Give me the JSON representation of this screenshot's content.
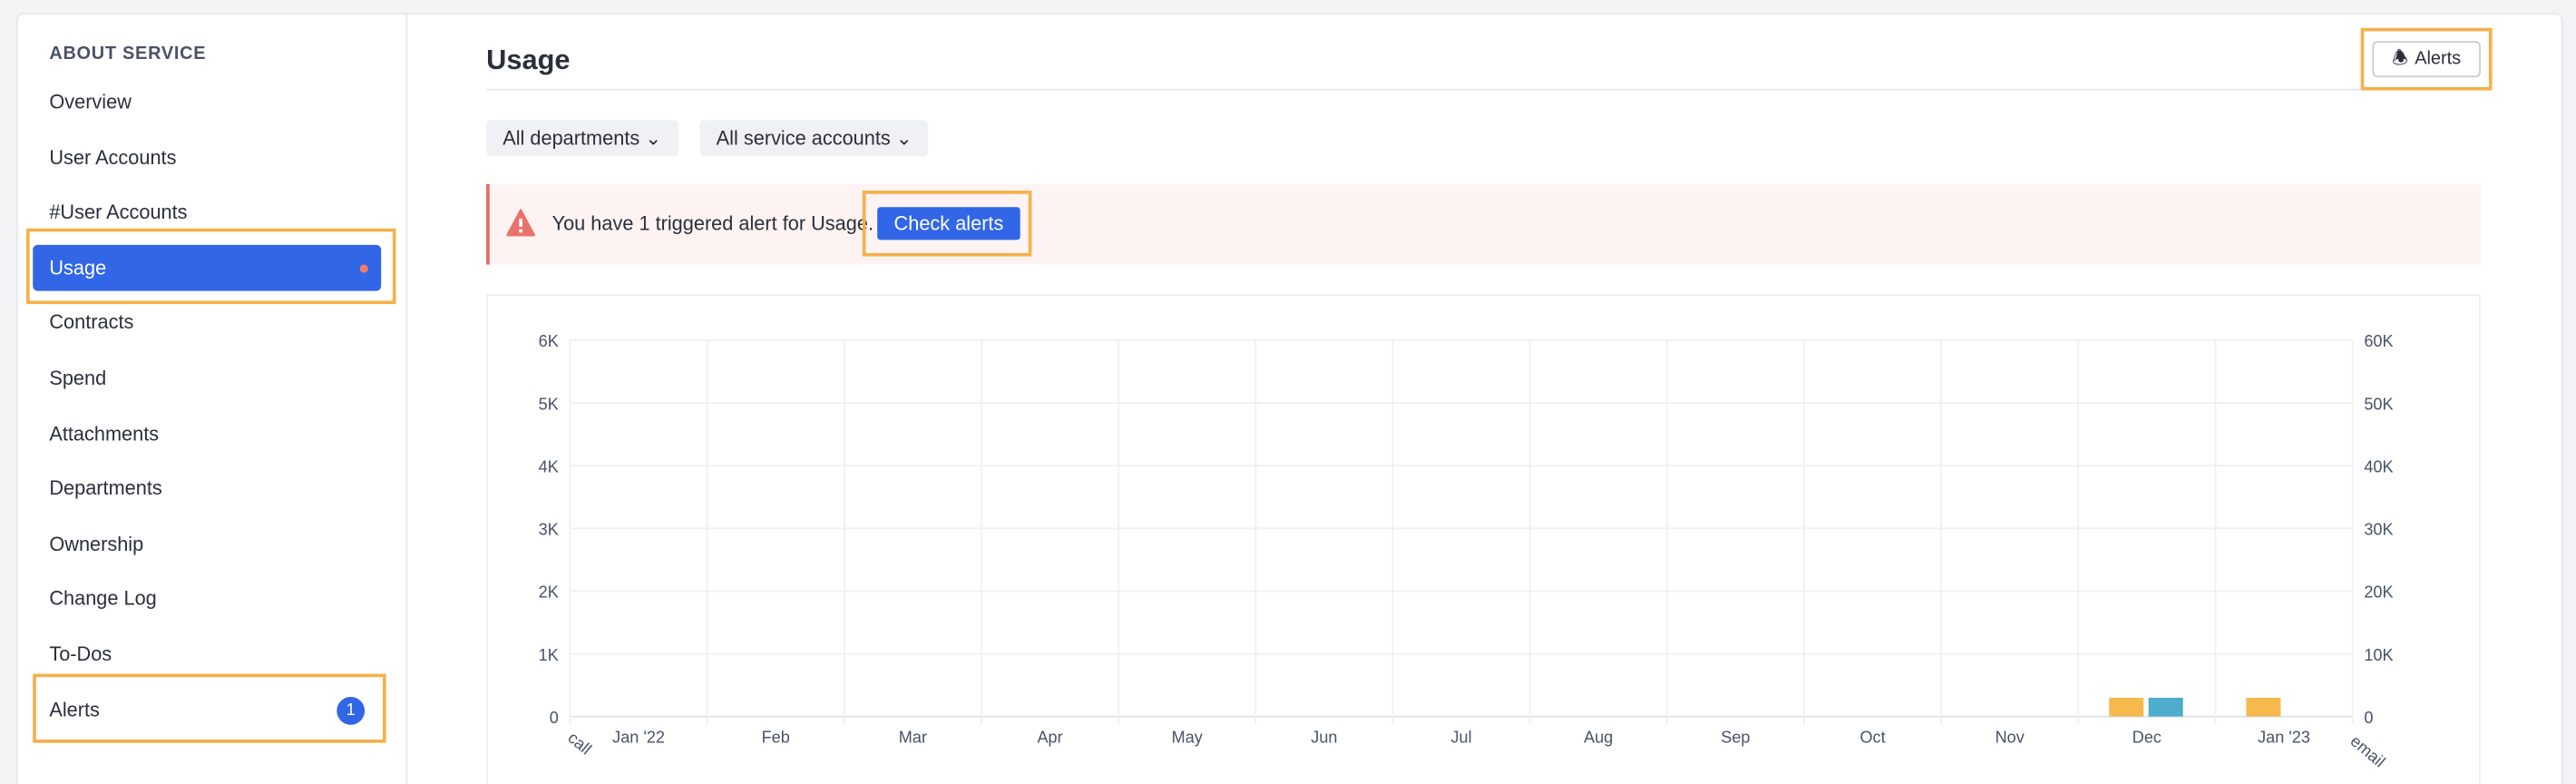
{
  "sidebar": {
    "heading": "ABOUT SERVICE",
    "items": [
      {
        "label": "Overview"
      },
      {
        "label": "User Accounts"
      },
      {
        "label": "#User Accounts"
      },
      {
        "label": "Usage"
      },
      {
        "label": "Contracts"
      },
      {
        "label": "Spend"
      },
      {
        "label": "Attachments"
      },
      {
        "label": "Departments"
      },
      {
        "label": "Ownership"
      },
      {
        "label": "Change Log"
      },
      {
        "label": "To-Dos"
      },
      {
        "label": "Alerts",
        "badge": "1"
      }
    ]
  },
  "header": {
    "title": "Usage",
    "alerts_button": "Alerts"
  },
  "filters": {
    "departments": "All departments",
    "service_accounts": "All service accounts"
  },
  "banner": {
    "message": "You have 1 triggered alert for Usage.",
    "button": "Check alerts"
  },
  "colors": {
    "accent": "#3166e6",
    "series_call": "#f5b94d",
    "series_email": "#4eaccc",
    "highlight": "#f5b04a"
  },
  "chart_data": {
    "type": "bar",
    "categories": [
      "Jan '22",
      "Feb",
      "Mar",
      "Apr",
      "May",
      "Jun",
      "Jul",
      "Aug",
      "Sep",
      "Oct",
      "Nov",
      "Dec",
      "Jan '23"
    ],
    "series": [
      {
        "name": "call",
        "axis": "left",
        "values": [
          0,
          0,
          0,
          0,
          0,
          0,
          0,
          0,
          0,
          0,
          0,
          300,
          300
        ]
      },
      {
        "name": "email",
        "axis": "right",
        "values": [
          0,
          0,
          0,
          0,
          0,
          0,
          0,
          0,
          0,
          0,
          0,
          3000,
          0
        ]
      }
    ],
    "left_axis": {
      "label": "call",
      "ticks": [
        "0",
        "1K",
        "2K",
        "3K",
        "4K",
        "5K",
        "6K"
      ],
      "ylim": [
        0,
        6000
      ]
    },
    "right_axis": {
      "label": "email",
      "ticks": [
        "0",
        "10K",
        "20K",
        "30K",
        "40K",
        "50K",
        "60K"
      ],
      "ylim": [
        0,
        60000
      ]
    },
    "grid": true
  }
}
